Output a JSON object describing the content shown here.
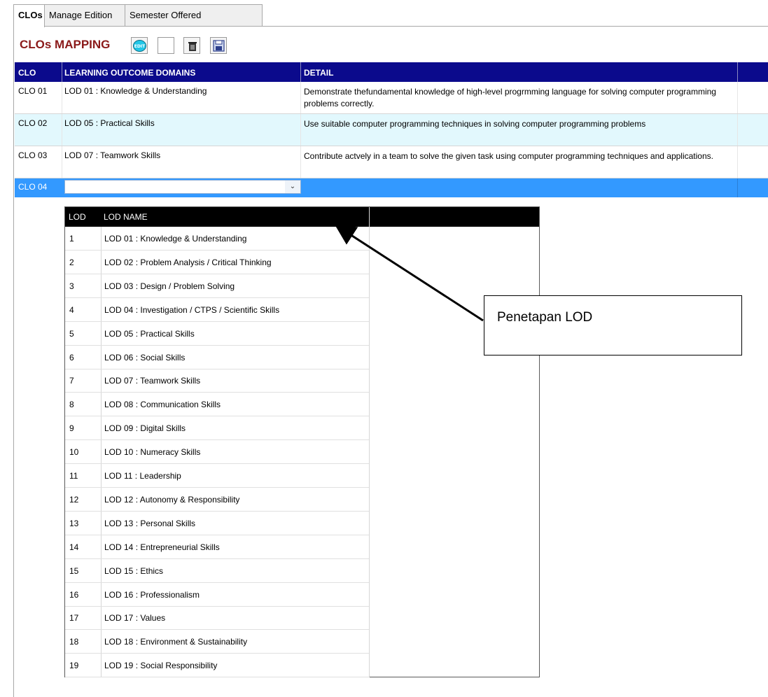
{
  "tabs": [
    "CLOs",
    "Manage Edition",
    "Semester Offered"
  ],
  "heading": "CLOs MAPPING",
  "toolbar": {
    "edit_label": "EDIT",
    "icons": [
      "edit-icon",
      "blank-button",
      "trash-icon",
      "save-icon"
    ]
  },
  "grid": {
    "headers": [
      "CLO",
      "LEARNING OUTCOME DOMAINS",
      "DETAIL"
    ],
    "rows": [
      {
        "clo": "CLO 01",
        "domain": "LOD 01 : Knowledge & Understanding",
        "detail": "Demonstrate thefundamental knowledge of high-level progrmming language for solving computer programming problems correctly."
      },
      {
        "clo": "CLO 02",
        "domain": "LOD 05 : Practical Skills",
        "detail": "Use suitable computer programming techniques in solving computer programming problems"
      },
      {
        "clo": "CLO 03",
        "domain": "LOD 07 : Teamwork Skills",
        "detail": "Contribute actvely in a team to solve the given task using computer programming techniques and applications."
      }
    ],
    "selected_row": {
      "clo": "CLO 04",
      "combo_value": ""
    }
  },
  "dropdown": {
    "headers": [
      "LOD",
      "LOD NAME"
    ],
    "items": [
      {
        "lod": "1",
        "name": "LOD 01 : Knowledge & Understanding"
      },
      {
        "lod": "2",
        "name": "LOD 02 : Problem Analysis / Critical Thinking"
      },
      {
        "lod": "3",
        "name": "LOD 03 : Design / Problem Solving"
      },
      {
        "lod": "4",
        "name": "LOD 04 : Investigation / CTPS / Scientific Skills"
      },
      {
        "lod": "5",
        "name": "LOD 05 : Practical Skills"
      },
      {
        "lod": "6",
        "name": "LOD 06 : Social Skills"
      },
      {
        "lod": "7",
        "name": "LOD 07 : Teamwork Skills"
      },
      {
        "lod": "8",
        "name": "LOD 08 : Communication Skills"
      },
      {
        "lod": "9",
        "name": "LOD 09 : Digital Skills"
      },
      {
        "lod": "10",
        "name": "LOD 10 : Numeracy Skills"
      },
      {
        "lod": "11",
        "name": "LOD 11 : Leadership"
      },
      {
        "lod": "12",
        "name": "LOD 12 : Autonomy & Responsibility"
      },
      {
        "lod": "13",
        "name": "LOD 13 : Personal Skills"
      },
      {
        "lod": "14",
        "name": "LOD 14 : Entrepreneurial Skills"
      },
      {
        "lod": "15",
        "name": "LOD 15 : Ethics"
      },
      {
        "lod": "16",
        "name": "LOD 16 : Professionalism"
      },
      {
        "lod": "17",
        "name": "LOD 17 : Values"
      },
      {
        "lod": "18",
        "name": "LOD 18 : Environment & Sustainability"
      },
      {
        "lod": "19",
        "name": "LOD 19 : Social Responsibility"
      }
    ]
  },
  "annotation": "Penetapan LOD",
  "colors": {
    "grid_header": "#0b0a8c",
    "selected_row": "#3399ff",
    "alt_row": "#e2f8fd",
    "heading": "#8b1a1a",
    "dropdown_header": "#000000"
  }
}
